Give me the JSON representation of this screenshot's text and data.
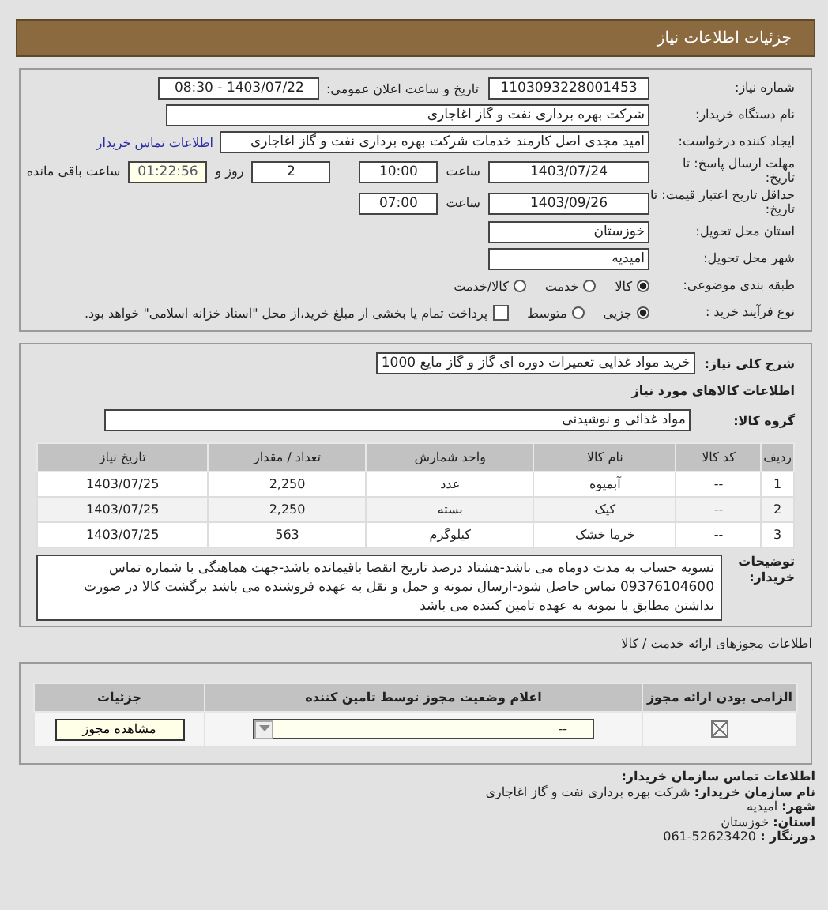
{
  "header": {
    "title": "جزئیات اطلاعات نیاز"
  },
  "need_number": {
    "label": "شماره نیاز:",
    "value": "1103093228001453"
  },
  "announce_date": {
    "label": "تاریخ و ساعت اعلان عمومی:",
    "value": "1403/07/22 - 08:30"
  },
  "buyer_org": {
    "label": "نام دستگاه خریدار:",
    "value": "شرکت بهره برداری نفت و گاز اغاجاری"
  },
  "requester": {
    "label": "ایجاد کننده درخواست:",
    "value": "امید مجدی اصل کارمند خدمات شرکت بهره برداری نفت و گاز اغاجاری",
    "link": "اطلاعات تماس خریدار"
  },
  "deadline": {
    "label": "مهلت ارسال پاسخ: تا تاریخ:",
    "date": "1403/07/24",
    "time_label": "ساعت",
    "time": "10:00",
    "days": "2",
    "days_label": "روز و",
    "remaining": "01:22:56",
    "remaining_label": "ساعت باقی مانده"
  },
  "validity": {
    "label": "حداقل تاریخ اعتبار قیمت: تا تاریخ:",
    "date": "1403/09/26",
    "time_label": "ساعت",
    "time": "07:00"
  },
  "province": {
    "label": "استان محل تحویل:",
    "value": "خوزستان"
  },
  "city": {
    "label": "شهر محل تحویل:",
    "value": "امیدیه"
  },
  "category": {
    "label": "طبقه بندی موضوعی:",
    "options": [
      {
        "label": "کالا",
        "selected": true
      },
      {
        "label": "خدمت",
        "selected": false
      },
      {
        "label": "کالا/خدمت",
        "selected": false
      }
    ]
  },
  "process": {
    "label": "نوع فرآیند خرید :",
    "options": [
      {
        "label": "جزیی",
        "selected": true
      },
      {
        "label": "متوسط",
        "selected": false
      }
    ],
    "treasury": {
      "checked": false,
      "label": "پرداخت تمام یا بخشی از مبلغ خرید،از محل \"اسناد خزانه اسلامی\" خواهد بود."
    }
  },
  "summary": {
    "label": "شرح کلی نیاز:",
    "value": "خرید مواد غذایی تعمیرات دوره ای گاز و گاز مایع 1000"
  },
  "goods_title": "اطلاعات کالاهای مورد نیاز",
  "goods_group": {
    "label": "گروه کالا:",
    "value": "مواد غذائی و نوشیدنی"
  },
  "goods_table": {
    "columns": [
      "ردیف",
      "کد کالا",
      "نام کالا",
      "واحد شمارش",
      "تعداد / مقدار",
      "تاریخ نیاز"
    ],
    "rows": [
      {
        "row": "1",
        "code": "--",
        "name": "آبمیوه",
        "unit": "عدد",
        "qty": "2,250",
        "date": "1403/07/25"
      },
      {
        "row": "2",
        "code": "--",
        "name": "کیک",
        "unit": "بسته",
        "qty": "2,250",
        "date": "1403/07/25"
      },
      {
        "row": "3",
        "code": "--",
        "name": "خرما خشک",
        "unit": "کیلوگرم",
        "qty": "563",
        "date": "1403/07/25"
      }
    ]
  },
  "buyer_notes": {
    "label": "توضیحات خریدار:",
    "value": "تسویه حساب به مدت دوماه می باشد-هشتاد درصد تاریخ انقضا باقیمانده باشد-جهت هماهنگی با شماره تماس 09376104600 تماس حاصل شود-ارسال نمونه و حمل و نقل به عهده فروشنده می باشد برگشت کالا در صورت نداشتن مطابق با نمونه به عهده تامین کننده می باشد"
  },
  "permits_title": "اطلاعات مجوزهای ارائه خدمت / کالا",
  "permits_table": {
    "columns": [
      "الزامی بودن ارائه مجوز",
      "اعلام وضعیت مجوز توسط تامین کننده",
      "جزئیات"
    ],
    "rows": [
      {
        "required": true,
        "status": "--",
        "button": "مشاهده مجوز"
      }
    ]
  },
  "contact": {
    "title": "اطلاعات تماس سازمان خریدار:",
    "lines": [
      "**نام سازمان خریدار:** شرکت بهره برداری نفت و گاز اغاجاری",
      "**شهر:** امیدیه",
      "**استان:** خوزستان",
      "**دورنگار :** 52623420-061"
    ]
  }
}
